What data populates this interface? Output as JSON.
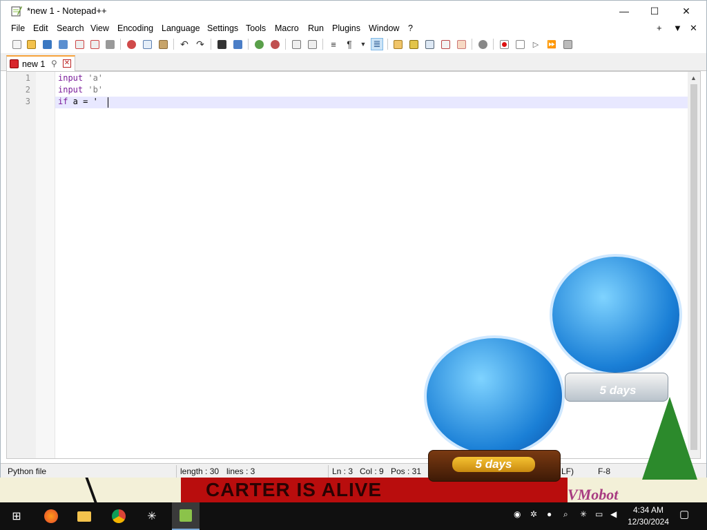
{
  "window": {
    "title": "*new 1 - Notepad++",
    "controls": {
      "minimize": "—",
      "maximize": "☐",
      "close": "✕"
    }
  },
  "menu": {
    "items": [
      "File",
      "Edit",
      "Search",
      "View",
      "Encoding",
      "Language",
      "Settings",
      "Tools",
      "Macro",
      "Run",
      "Plugins",
      "Window",
      "?"
    ],
    "right": [
      "+",
      "▼",
      "✕"
    ]
  },
  "toolbar_icons": [
    "new-file-icon",
    "open-file-icon",
    "save-icon",
    "save-all-icon",
    "close-icon",
    "close-all-icon",
    "print-icon",
    "cut-icon",
    "copy-icon",
    "paste-icon",
    "undo-icon",
    "redo-icon",
    "find-icon",
    "replace-icon",
    "zoom-in-icon",
    "zoom-out-icon",
    "sync-vertical-icon",
    "sync-horizontal-icon",
    "word-wrap-icon",
    "show-all-chars-icon",
    "dropdown-icon",
    "indent-guide-icon",
    "user-define-lang-icon",
    "doc-map-icon",
    "doc-list-icon",
    "function-list-icon",
    "folder-as-workspace-icon",
    "monitoring-icon",
    "record-macro-icon",
    "stop-record-icon",
    "playback-icon",
    "run-multiple-icon",
    "save-macro-icon"
  ],
  "tab": {
    "label": "new 1",
    "pin": "⚲",
    "close": "✕"
  },
  "editor": {
    "lines": [
      {
        "number": "1",
        "keyword": "input",
        "rest": " 'a'"
      },
      {
        "number": "2",
        "keyword": "input",
        "rest": " 'b'"
      },
      {
        "number": "3",
        "keyword": "if",
        "rest": " a = '"
      }
    ]
  },
  "status": {
    "file_type": "Python file",
    "length": "length : 30",
    "lines": "lines : 3",
    "ln": "Ln : 3",
    "col": "Col : 9",
    "pos": "Pos : 31",
    "eol": "LF)",
    "encoding": "F-8"
  },
  "desktop": {
    "banner": "CARTER IS ALIVE",
    "watermark": "VMobot",
    "globe_badges": [
      "5 days",
      "5 days"
    ]
  },
  "taskbar": {
    "apps": [
      "start-icon",
      "firefox-icon",
      "file-explorer-icon",
      "chrome-icon",
      "snowflake-app-icon",
      "notepadpp-icon"
    ],
    "time": "4:34 AM",
    "date": "12/30/2024"
  }
}
